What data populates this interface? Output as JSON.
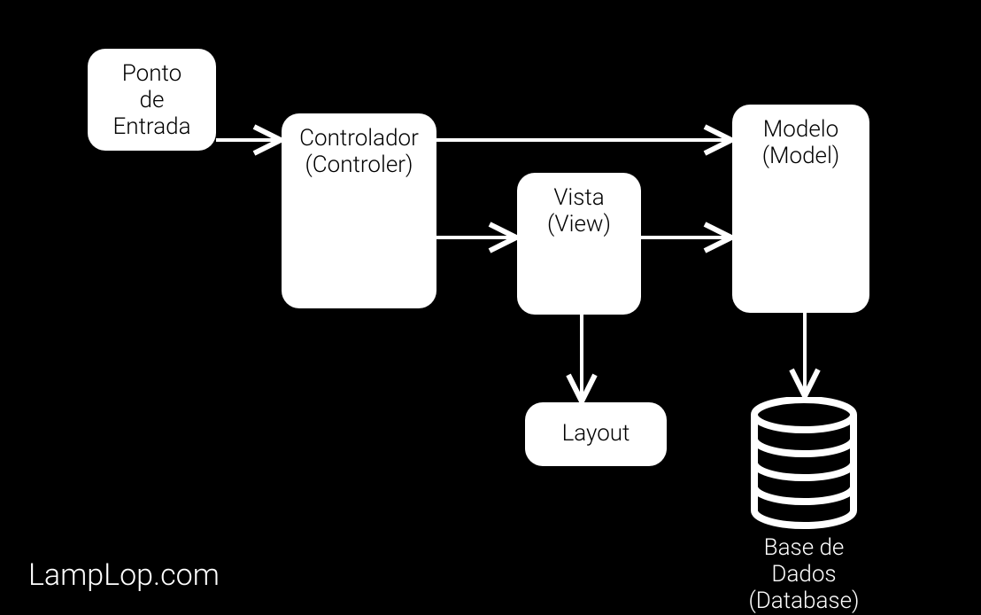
{
  "nodes": {
    "entry": {
      "line1": "Ponto",
      "line2": "de",
      "line3": "Entrada"
    },
    "controller": {
      "line1": "Controlador",
      "line2": "(Controler)"
    },
    "view": {
      "line1": "Vista",
      "line2": "(View)"
    },
    "model": {
      "line1": "Modelo",
      "line2": "(Model)"
    },
    "layout": {
      "line1": "Layout"
    },
    "database": {
      "line1": "Base de Dados",
      "line2": "(Database)"
    }
  },
  "watermark": "LampLop.com"
}
